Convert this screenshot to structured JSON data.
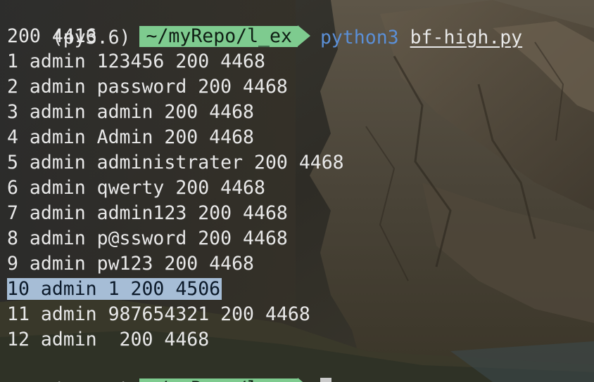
{
  "prompt": {
    "venv": "(py3.6)",
    "path": "~/myRepo/l_ex"
  },
  "command": {
    "program": "python3",
    "script": "bf-high.py"
  },
  "output": [
    "200 4416",
    "1 admin 123456 200 4468",
    "2 admin password 200 4468",
    "3 admin admin 200 4468",
    "4 admin Admin 200 4468",
    "5 admin administrater 200 4468",
    "6 admin qwerty 200 4468",
    "7 admin admin123 200 4468",
    "8 admin p@ssword 200 4468",
    "9 admin pw123 200 4468",
    "10 admin 1 200 4506",
    "11 admin 987654321 200 4468",
    "12 admin  200 4468"
  ]
}
